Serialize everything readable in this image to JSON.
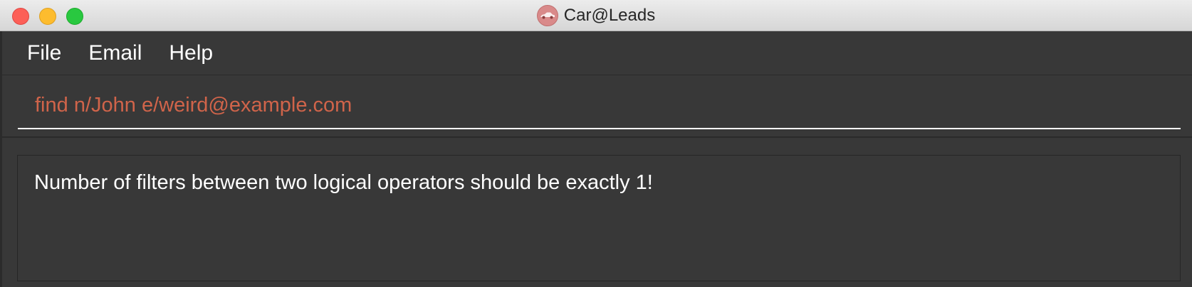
{
  "window": {
    "title": "Car@Leads",
    "app_icon": "car-icon"
  },
  "menu": {
    "items": [
      {
        "label": "File"
      },
      {
        "label": "Email"
      },
      {
        "label": "Help"
      }
    ]
  },
  "command_box": {
    "value": "find n/John e/weird@example.com",
    "text_color": "#d0644a"
  },
  "result_display": {
    "message": "Number of filters between two logical operators should be exactly 1!"
  },
  "colors": {
    "background": "#383838",
    "title_bar": "#e0e0e0",
    "error_text": "#d0644a",
    "text": "#ffffff"
  }
}
